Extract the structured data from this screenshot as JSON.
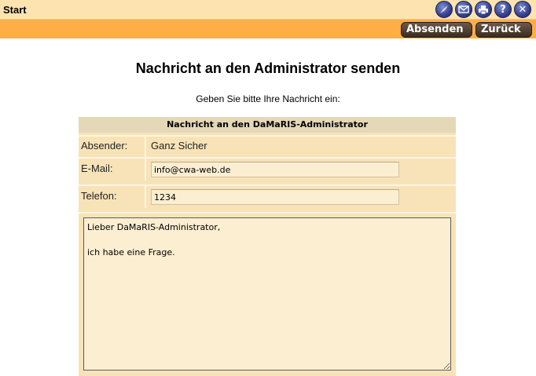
{
  "topbar": {
    "title": "Start",
    "icons": [
      "compass-icon",
      "mail-icon",
      "printer-icon",
      "help-icon",
      "close-icon"
    ],
    "help_glyph": "?",
    "close_glyph": "✕"
  },
  "toolbar": {
    "send_label": "Absenden",
    "back_label": "Zurück"
  },
  "page": {
    "heading": "Nachricht an den Administrator senden",
    "instruction": "Geben Sie bitte Ihre Nachricht ein:"
  },
  "form": {
    "header": "Nachricht an den DaMaRIS-Administrator",
    "sender_label": "Absender:",
    "sender_value": "Ganz Sicher",
    "email_label": "E-Mail:",
    "email_value": "info@cwa-web.de",
    "phone_label": "Telefon:",
    "phone_value": "1234",
    "message_value": "Lieber DaMaRIS-Administrator,\n\nich habe eine Frage."
  },
  "colors": {
    "topbar": "#fde3b0",
    "orangebar": "#ffae45",
    "form_bg": "#f8e3b8",
    "form_header": "#e4d8b8",
    "button": "#3b2c22",
    "icon": "#34418a"
  }
}
